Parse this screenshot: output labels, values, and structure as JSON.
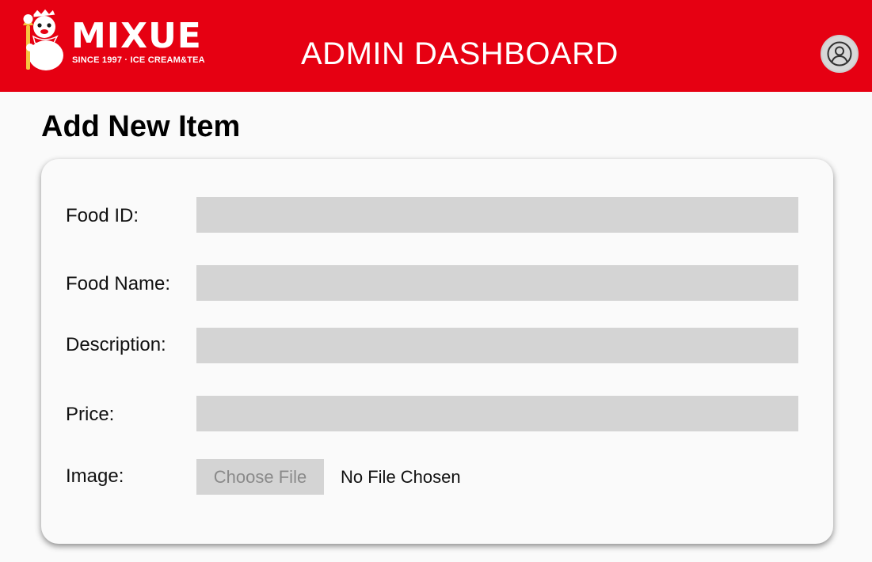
{
  "header": {
    "logo": {
      "wordmark": "MIXUE",
      "tagline": "SINCE 1997 · ICE CREAM&TEA",
      "mascot_icon": "snow-king-mascot-icon"
    },
    "title": "ADMIN DASHBOARD",
    "avatar_icon": "user-circle-icon"
  },
  "main": {
    "page_title": "Add New Item",
    "form": {
      "fields": [
        {
          "label": "Food ID:",
          "value": "",
          "placeholder": ""
        },
        {
          "label": "Food Name:",
          "value": "",
          "placeholder": ""
        },
        {
          "label": "Description:",
          "value": "",
          "placeholder": ""
        },
        {
          "label": "Price:",
          "value": "",
          "placeholder": ""
        }
      ],
      "image": {
        "label": "Image:",
        "button_label": "Choose File",
        "status": "No File Chosen"
      }
    }
  },
  "colors": {
    "brand_red": "#e60012",
    "input_gray": "#d4d4d4",
    "background": "#fafafa"
  }
}
